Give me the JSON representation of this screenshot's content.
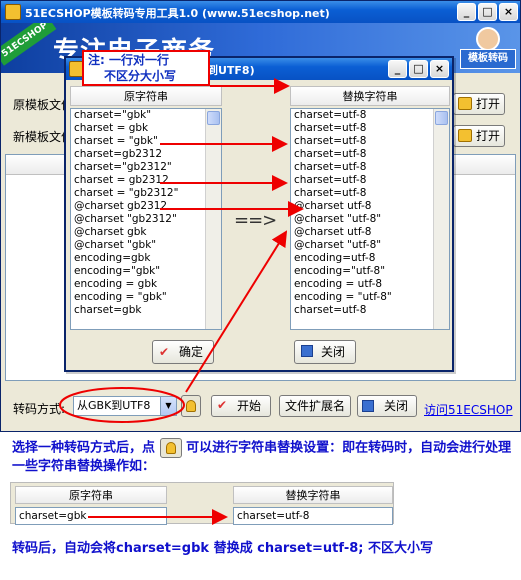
{
  "main_window": {
    "title": "51ECSHOP模板转码专用工具1.0 (www.51ecshop.net)",
    "banner_slogan": "专注电子商务",
    "banner_ribbon": "51ECSHOP",
    "banner_label": "模板转码",
    "source_label": "原模板文件",
    "new_label": "新模板文件",
    "open_button": "打开",
    "mode_label": "转码方式:",
    "mode_value": "从GBK到UTF8",
    "start_button": "开始",
    "ext_button": "文件扩展名",
    "close_button": "关闭",
    "visit_link": "访问51ECSHOP"
  },
  "dialog": {
    "title": "替换字符串列表(从GBK到UTF8)",
    "col_original": "原字符串",
    "col_replace": "替换字符串",
    "note_line1": "注: 一行对一行",
    "note_line2": "不区分大小写",
    "middle_arrow": "==>",
    "ok_button": "确定",
    "close_button": "关闭",
    "original": [
      "charset=gbk",
      "charset=\"gbk\"",
      "charset = gbk",
      "charset = \"gbk\"",
      "charset=gb2312",
      "charset=\"gb2312\"",
      "charset = gb2312",
      "charset = \"gb2312\"",
      "@charset gb2312",
      "@charset \"gb2312\"",
      "@charset gbk",
      "@charset \"gbk\"",
      "encoding=gbk",
      "encoding=\"gbk\"",
      "encoding = gbk",
      "encoding = \"gbk\""
    ],
    "replacement": [
      "charset=utf-8",
      "charset=utf-8",
      "charset=utf-8",
      "charset=utf-8",
      "charset=utf-8",
      "charset=utf-8",
      "charset=utf-8",
      "charset=utf-8",
      "@charset utf-8",
      "@charset \"utf-8\"",
      "@charset utf-8",
      "@charset \"utf-8\"",
      "encoding=utf-8",
      "encoding=\"utf-8\"",
      "encoding = utf-8",
      "encoding = \"utf-8\""
    ]
  },
  "explanation": {
    "para1_a": "选择一种转码方式后，点",
    "para1_b": "可以进行字符串替换设置：即在转码时，自动会进行处理一些字符串替换操作如：",
    "example_col_original": "原字符串",
    "example_col_replace": "替换字符串",
    "example_original": "charset=gbk",
    "example_replace": "charset=utf-8",
    "para2": "转码后，自动会将charset=gbk 替换成 charset=utf-8; 不区大小写"
  },
  "colors": {
    "title_bar": "#0b5fd4",
    "annotation_red": "#e00000",
    "explanation_blue": "#1010cc",
    "window_bg": "#ece9d8"
  }
}
